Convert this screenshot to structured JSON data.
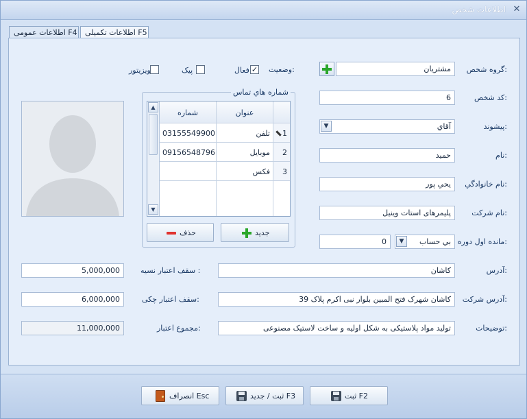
{
  "window": {
    "title": "اطلاعات شخص",
    "close_symbol": "✕"
  },
  "tabs": [
    {
      "label": "اطلاعات عمومی F4",
      "active": false
    },
    {
      "label": "اطلاعات تکمیلی F5",
      "active": true
    }
  ],
  "form": {
    "person_group_label": "گروه شخص:",
    "person_group_value": "مشتریان",
    "status_label": "وضعیت:",
    "active_label": "فعال",
    "active_checked": "✓",
    "courier_label": "پیک",
    "visitor_label": "ویزیتور",
    "person_code_label": "کد شخص:",
    "person_code_value": "6",
    "prefix_label": "پیشوند:",
    "prefix_value": "آقاي",
    "name_label": "نام:",
    "name_value": "حمید",
    "family_label": "نام خانوادگي:",
    "family_value": "يحي پور",
    "company_label": "نام شرکت:",
    "company_value": "پلیمرهای استات وینیل",
    "opening_balance_label": "مانده اول دوره:",
    "opening_balance_type": "بي حساب",
    "opening_balance_value": "0",
    "address_label": "آدرس:",
    "address_value": "کاشان",
    "company_address_label": "آدرس شرکت:",
    "company_address_value": "کاشان شهرک فتح المبین بلوار نبی اکرم پلاک 39",
    "description_label": "توضیحات:",
    "description_value": "تولید مواد پلاستیکی به شکل اولیه و ساخت لاستیک مصنوعی",
    "credit_limit_label": "سقف اعتبار نسیه :",
    "credit_limit_value": "5,000,000",
    "check_credit_label": "سقف اعتبار چکی:",
    "check_credit_value": "6,000,000",
    "total_credit_label": "مجموع اعتبار:",
    "total_credit_value": "11,000,000"
  },
  "contacts": {
    "legend": "شماره هاي تماس",
    "headers": {
      "title": "عنوان",
      "number": "شماره"
    },
    "rows": [
      {
        "index": "1",
        "title": "تلفن",
        "number": "03155549900"
      },
      {
        "index": "2",
        "title": "موبایل",
        "number": "09156548796"
      },
      {
        "index": "3",
        "title": "فکس",
        "number": ""
      }
    ],
    "new_button": "جدید",
    "delete_button": "حذف"
  },
  "footer": {
    "save_button": "ثبت F2",
    "save_new_button": "ثبت / جدید F3",
    "cancel_button": "انصراف Esc"
  },
  "colors": {
    "accent_green": "#2aa62a",
    "delete_red": "#e0332f"
  }
}
